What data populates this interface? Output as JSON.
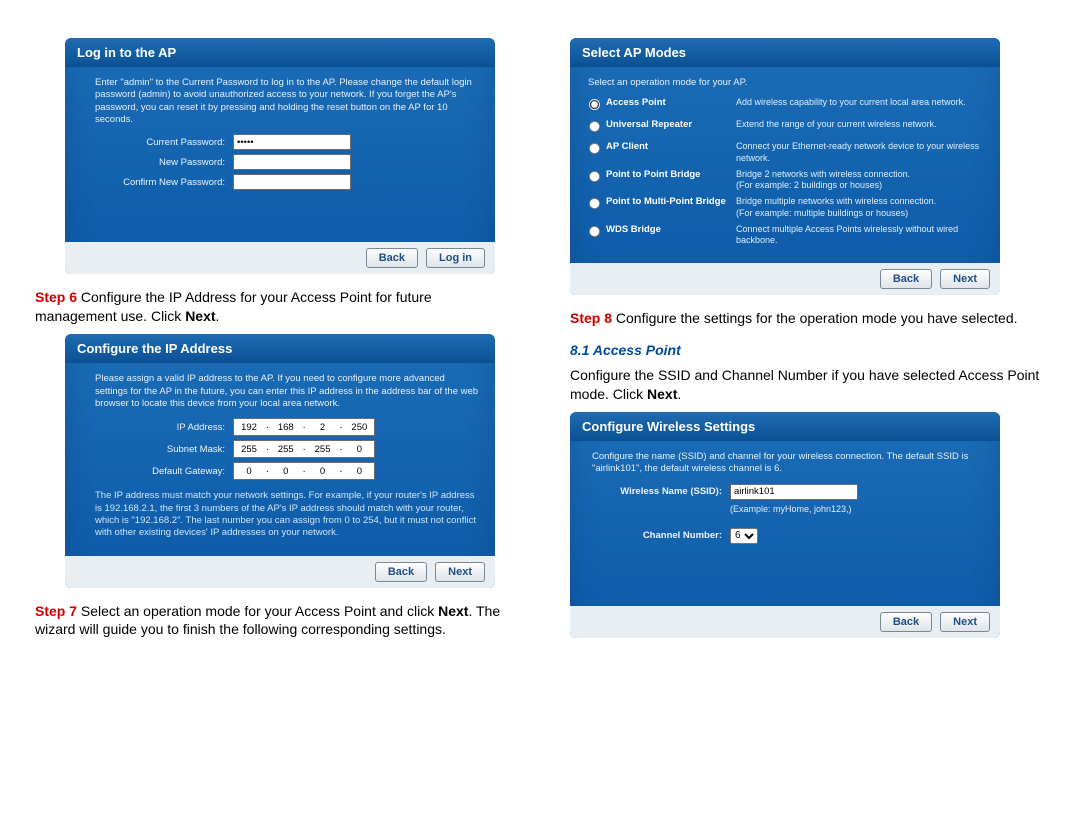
{
  "left": {
    "login_panel": {
      "title": "Log in to the AP",
      "intro": "Enter \"admin\" to the Current Password to log in to the AP. Please change the default login password (admin) to avoid unauthorized access to your network. If you forget the AP's password, you can reset it by pressing and holding the reset button on the AP for 10 seconds.",
      "fields": {
        "current_password_label": "Current Password:",
        "current_password_value": "•••••",
        "new_password_label": "New Password:",
        "new_password_value": "",
        "confirm_password_label": "Confirm New Password:",
        "confirm_password_value": ""
      },
      "buttons": {
        "back": "Back",
        "login": "Log in"
      }
    },
    "step6": {
      "label": "Step 6",
      "text": " Configure the IP Address for your Access Point for future management use. Click ",
      "next": "Next",
      "period": "."
    },
    "ip_panel": {
      "title": "Configure the IP Address",
      "intro": "Please assign a valid IP address to the AP. If you need to configure more advanced settings for the AP in the future, you can enter this IP address in the address bar of the web browser to locate this device from your local area network.",
      "labels": {
        "ip": "IP Address:",
        "subnet": "Subnet Mask:",
        "gateway": "Default Gateway:"
      },
      "ip": [
        "192",
        "168",
        "2",
        "250"
      ],
      "subnet": [
        "255",
        "255",
        "255",
        "0"
      ],
      "gateway": [
        "0",
        "0",
        "0",
        "0"
      ],
      "note": "The IP address must match your network settings. For example, if your router's IP address is 192.168.2.1, the first 3 numbers of the AP's IP address should match with your router, which is \"192.168.2\". The last number you can assign from 0 to 254, but it must not conflict with other existing devices' IP addresses on your network.",
      "buttons": {
        "back": "Back",
        "next": "Next"
      }
    },
    "step7": {
      "label": "Step 7",
      "text1": " Select an operation mode for your Access Point and click ",
      "next": "Next",
      "text2": ". The wizard will guide you to finish the following corresponding settings."
    }
  },
  "right": {
    "modes_panel": {
      "title": "Select AP Modes",
      "intro": "Select an operation mode for your AP.",
      "selected_index": 0,
      "modes": [
        {
          "name": "Access Point",
          "desc": "Add wireless capability to your current local area network."
        },
        {
          "name": "Universal Repeater",
          "desc": "Extend the range of your current wireless network."
        },
        {
          "name": "AP Client",
          "desc": "Connect your Ethernet-ready network device to your wireless network."
        },
        {
          "name": "Point to Point Bridge",
          "desc": "Bridge 2 networks with wireless connection.\n(For example: 2 buildings or houses)"
        },
        {
          "name": "Point to Multi-Point Bridge",
          "desc": "Bridge multiple networks with wireless connection.\n(For example: multiple buildings or houses)"
        },
        {
          "name": "WDS Bridge",
          "desc": "Connect multiple Access Points wirelessly without wired backbone."
        }
      ],
      "buttons": {
        "back": "Back",
        "next": "Next"
      }
    },
    "step8": {
      "label": "Step 8",
      "text": " Configure the settings for the operation mode you have selected."
    },
    "subheading": "8.1 Access Point",
    "substep": {
      "text1": "Configure the SSID and Channel Number if you have selected Access Point mode. Click ",
      "next": "Next",
      "period": "."
    },
    "wireless_panel": {
      "title": "Configure Wireless Settings",
      "intro": "Configure the name (SSID) and channel for your wireless connection. The default SSID is \"airlink101\", the default wireless channel is 6.",
      "ssid_label": "Wireless Name (SSID):",
      "ssid_value": "airlink101",
      "example": "(Example: myHome, john123,)",
      "channel_label": "Channel Number:",
      "channel_value": "6",
      "buttons": {
        "back": "Back",
        "next": "Next"
      }
    }
  }
}
